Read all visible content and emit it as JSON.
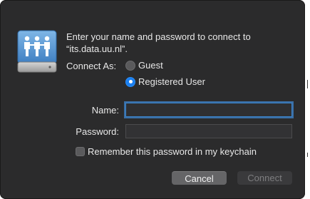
{
  "dialog": {
    "message_line1": "Enter your name and password to connect to",
    "message_line2": "“its.data.uu.nl”.",
    "connect_as_label": "Connect As:",
    "options": {
      "guest": "Guest",
      "registered": "Registered User"
    },
    "selected_option": "Registered User",
    "name_label": "Name:",
    "name_value": "",
    "password_label": "Password:",
    "password_value": "",
    "remember_label": "Remember this password in my keychain",
    "remember_checked": false,
    "cancel_label": "Cancel",
    "connect_label": "Connect",
    "connect_enabled": false
  },
  "icons": {
    "server": "shared-server-drive-icon"
  },
  "colors": {
    "dialog_bg": "#2b2b2c",
    "accent": "#1a7ff0",
    "focus_ring": "#3a6fa6"
  }
}
